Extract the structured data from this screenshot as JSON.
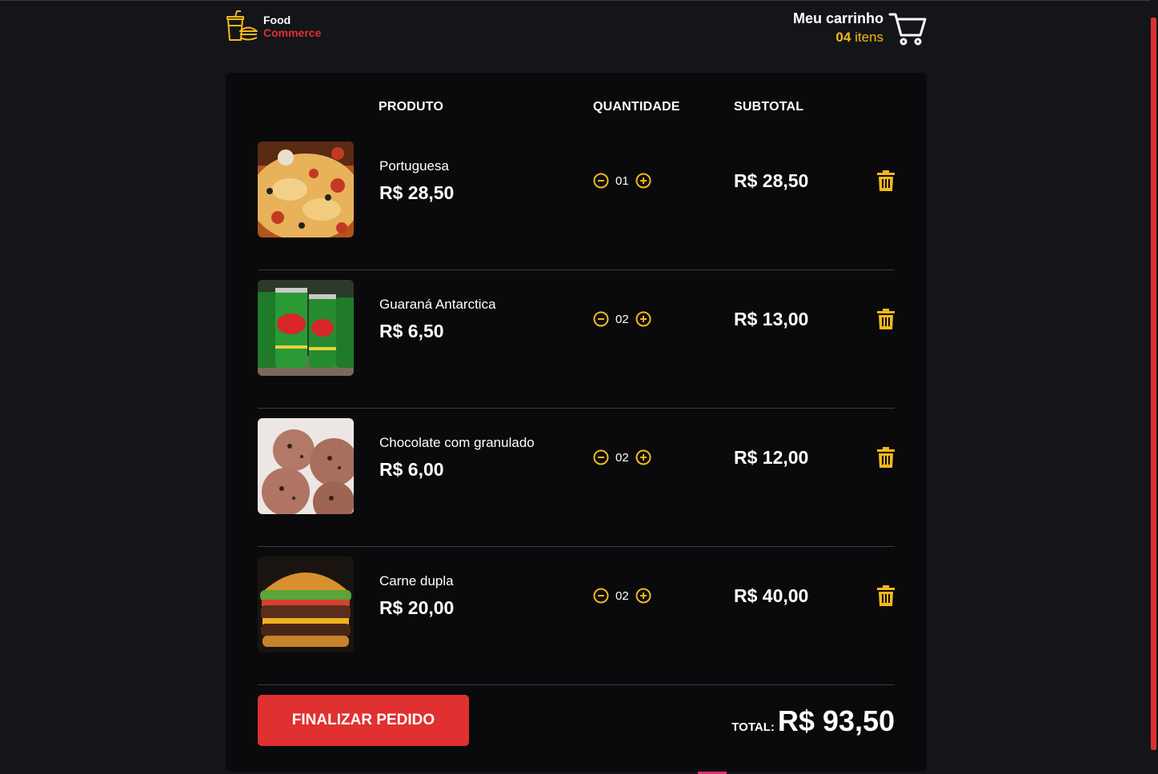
{
  "brand": {
    "line1": "Food",
    "line2": "Commerce",
    "icon": "food-drink-burger-icon"
  },
  "cart": {
    "title": "Meu carrinho",
    "count": "04",
    "count_suffix": "itens",
    "icon": "shopping-cart-icon"
  },
  "table": {
    "headers": {
      "produto": "PRODUTO",
      "quantidade": "QUANTIDADE",
      "subtotal": "SUBTOTAL"
    },
    "items": [
      {
        "name": "Portuguesa",
        "price": "R$ 28,50",
        "quantity": "01",
        "subtotal": "R$ 28,50",
        "image": "pizza"
      },
      {
        "name": "Guaraná Antarctica",
        "price": "R$ 6,50",
        "quantity": "02",
        "subtotal": "R$ 13,00",
        "image": "soda-cans"
      },
      {
        "name": "Chocolate com granulado",
        "price": "R$ 6,00",
        "quantity": "02",
        "subtotal": "R$ 12,00",
        "image": "ice-cream"
      },
      {
        "name": "Carne dupla",
        "price": "R$ 20,00",
        "quantity": "02",
        "subtotal": "R$ 40,00",
        "image": "burger"
      }
    ]
  },
  "footer": {
    "finalize_label": "FINALIZAR PEDIDO",
    "total_label": "TOTAL:",
    "total_value": "R$ 93,50"
  },
  "colors": {
    "background": "#141519",
    "panel": "#0a0a0c",
    "accent_red": "#e03030",
    "accent_yellow": "#f5b81c"
  }
}
